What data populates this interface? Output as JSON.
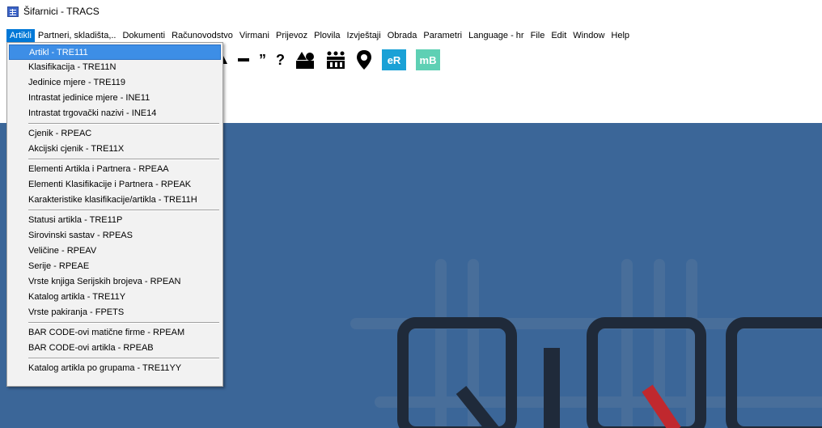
{
  "window": {
    "title": "Šifarnici - TRACS",
    "icon": "app-grid-icon"
  },
  "menubar": {
    "items": [
      {
        "label": "Artikli",
        "active": true
      },
      {
        "label": "Partneri, skladišta,.."
      },
      {
        "label": "Dokumenti"
      },
      {
        "label": "Računovodstvo"
      },
      {
        "label": "Virmani"
      },
      {
        "label": "Prijevoz"
      },
      {
        "label": "Plovila"
      },
      {
        "label": "Izvještaji"
      },
      {
        "label": "Obrada"
      },
      {
        "label": "Parametri"
      },
      {
        "label": "Language - hr"
      },
      {
        "label": "File"
      },
      {
        "label": "Edit"
      },
      {
        "label": "Window"
      },
      {
        "label": "Help"
      }
    ]
  },
  "toolbar": {
    "quote_label": "”",
    "question_label": "?",
    "er_label": "eR",
    "mb_label": "mB",
    "colors": {
      "er": "#1aa1d6",
      "mb": "#5ed0b4"
    }
  },
  "dropdown": {
    "groups": [
      [
        "Artikl - TRE111",
        "Klasifikacija - TRE11N",
        "Jedinice mjere - TRE119",
        "Intrastat jedinice mjere - INE11",
        "Intrastat trgovački nazivi - INE14"
      ],
      [
        "Cjenik - RPEAC",
        "Akcijski cjenik - TRE11X"
      ],
      [
        "Elementi Artikla i Partnera - RPEAA",
        "Elementi Klasifikacije i Partnera - RPEAK",
        "Karakteristike klasifikacije/artikla - TRE11H"
      ],
      [
        "Statusi artikla - TRE11P",
        "Sirovinski sastav - RPEAS",
        "Veličine - RPEAV",
        "Serije - RPEAE",
        "Vrste knjiga Serijskih brojeva - RPEAN",
        "Katalog artikla - TRE11Y",
        "Vrste pakiranja - FPETS"
      ],
      [
        "BAR CODE-ovi matične firme - RPEAM",
        "BAR CODE-ovi artikla - RPEAB"
      ],
      [
        "Katalog artikla po grupama - TRE11YY"
      ]
    ],
    "selected": "Artikl - TRE111"
  },
  "colors": {
    "workspace": "#3b6698",
    "menu_highlight": "#0078d7",
    "logo_dark": "#1f2a3a",
    "logo_red": "#c0282e"
  }
}
